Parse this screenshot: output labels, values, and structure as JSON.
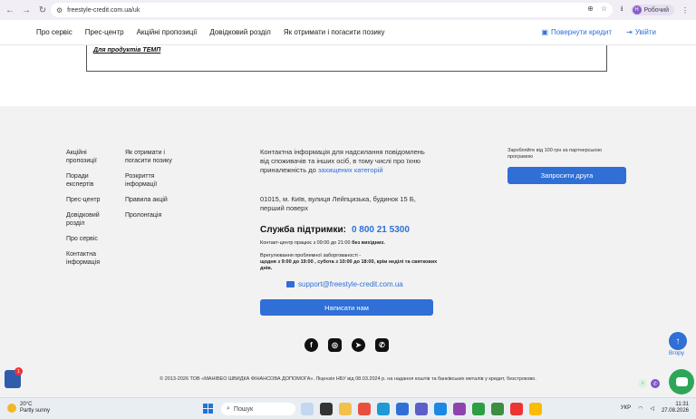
{
  "browser": {
    "url": "freestyle-credit.com.ua/uk",
    "profile_initial": "Н",
    "profile_name": "Робочий"
  },
  "header": {
    "nav": [
      "Про сервіс",
      "Прес-центр",
      "Акційні пропозиції",
      "Довідковий розділ",
      "Як отримати і погасити позику"
    ],
    "return_credit": "Повернути кредит",
    "login": "Увійти"
  },
  "content": {
    "link": "Для продуктів ТЕМП"
  },
  "footer": {
    "col1": [
      "Акційні пропозиції",
      "Поради експертів",
      "Прес-центр",
      "Довідковий розділ",
      "Про сервіс",
      "Контактна інформація"
    ],
    "col2": [
      "Як отримати і погасити позику",
      "Розкриття інформації",
      "Правила акцій",
      "Пролонгація"
    ],
    "contact_text": "Контактна інформація для надсилання повідомлень від споживачів та інших осіб, в тому числі про їхню приналежність до",
    "contact_link": "захищених категорій",
    "address": "01015, м. Київ, вулиця Лейпцизька, будинок 15 Б, перший поверх",
    "support_label": "Служба підтримки:",
    "support_phone": "0 800 21 5300",
    "hours_text": "Контакт-центр працює з 09:00 до 21:00",
    "hours_bold": "без вихідних.",
    "complaint_text": "Врегулювання проблемної заборгованості -",
    "complaint_bold": "щодня з 9:00 до 19:00 , суботa з 10:00 до 18:00, крім неділі та святкових днів.",
    "email": "support@freestyle-credit.com.ua",
    "write_button": "Написати нам",
    "partner_text": "Заробляйте від 100 грн за партнерською програмою",
    "invite_button": "Запросити друга",
    "up_label": "Вгору",
    "copyright": "© 2013-2026 ТОВ «МАНІВЕО ШВИДКА ФІНАНСОВА ДОПОМОГА». Ліцензія НБУ від 08.03.2024 р. на надання коштів та банківських металів у кредит, безстроково.",
    "socials": [
      "facebook-icon",
      "instagram-icon",
      "telegram-icon",
      "viber-icon"
    ]
  },
  "taskbar": {
    "temperature": "20°C",
    "weather": "Partly sunny",
    "search": "Пошук",
    "language": "УКР",
    "time": "11:31",
    "date": "27.08.2026"
  },
  "colors": {
    "accent": "#2f6fd6",
    "footer_bg": "#f2f2f2",
    "chat": "#2ea65a"
  }
}
